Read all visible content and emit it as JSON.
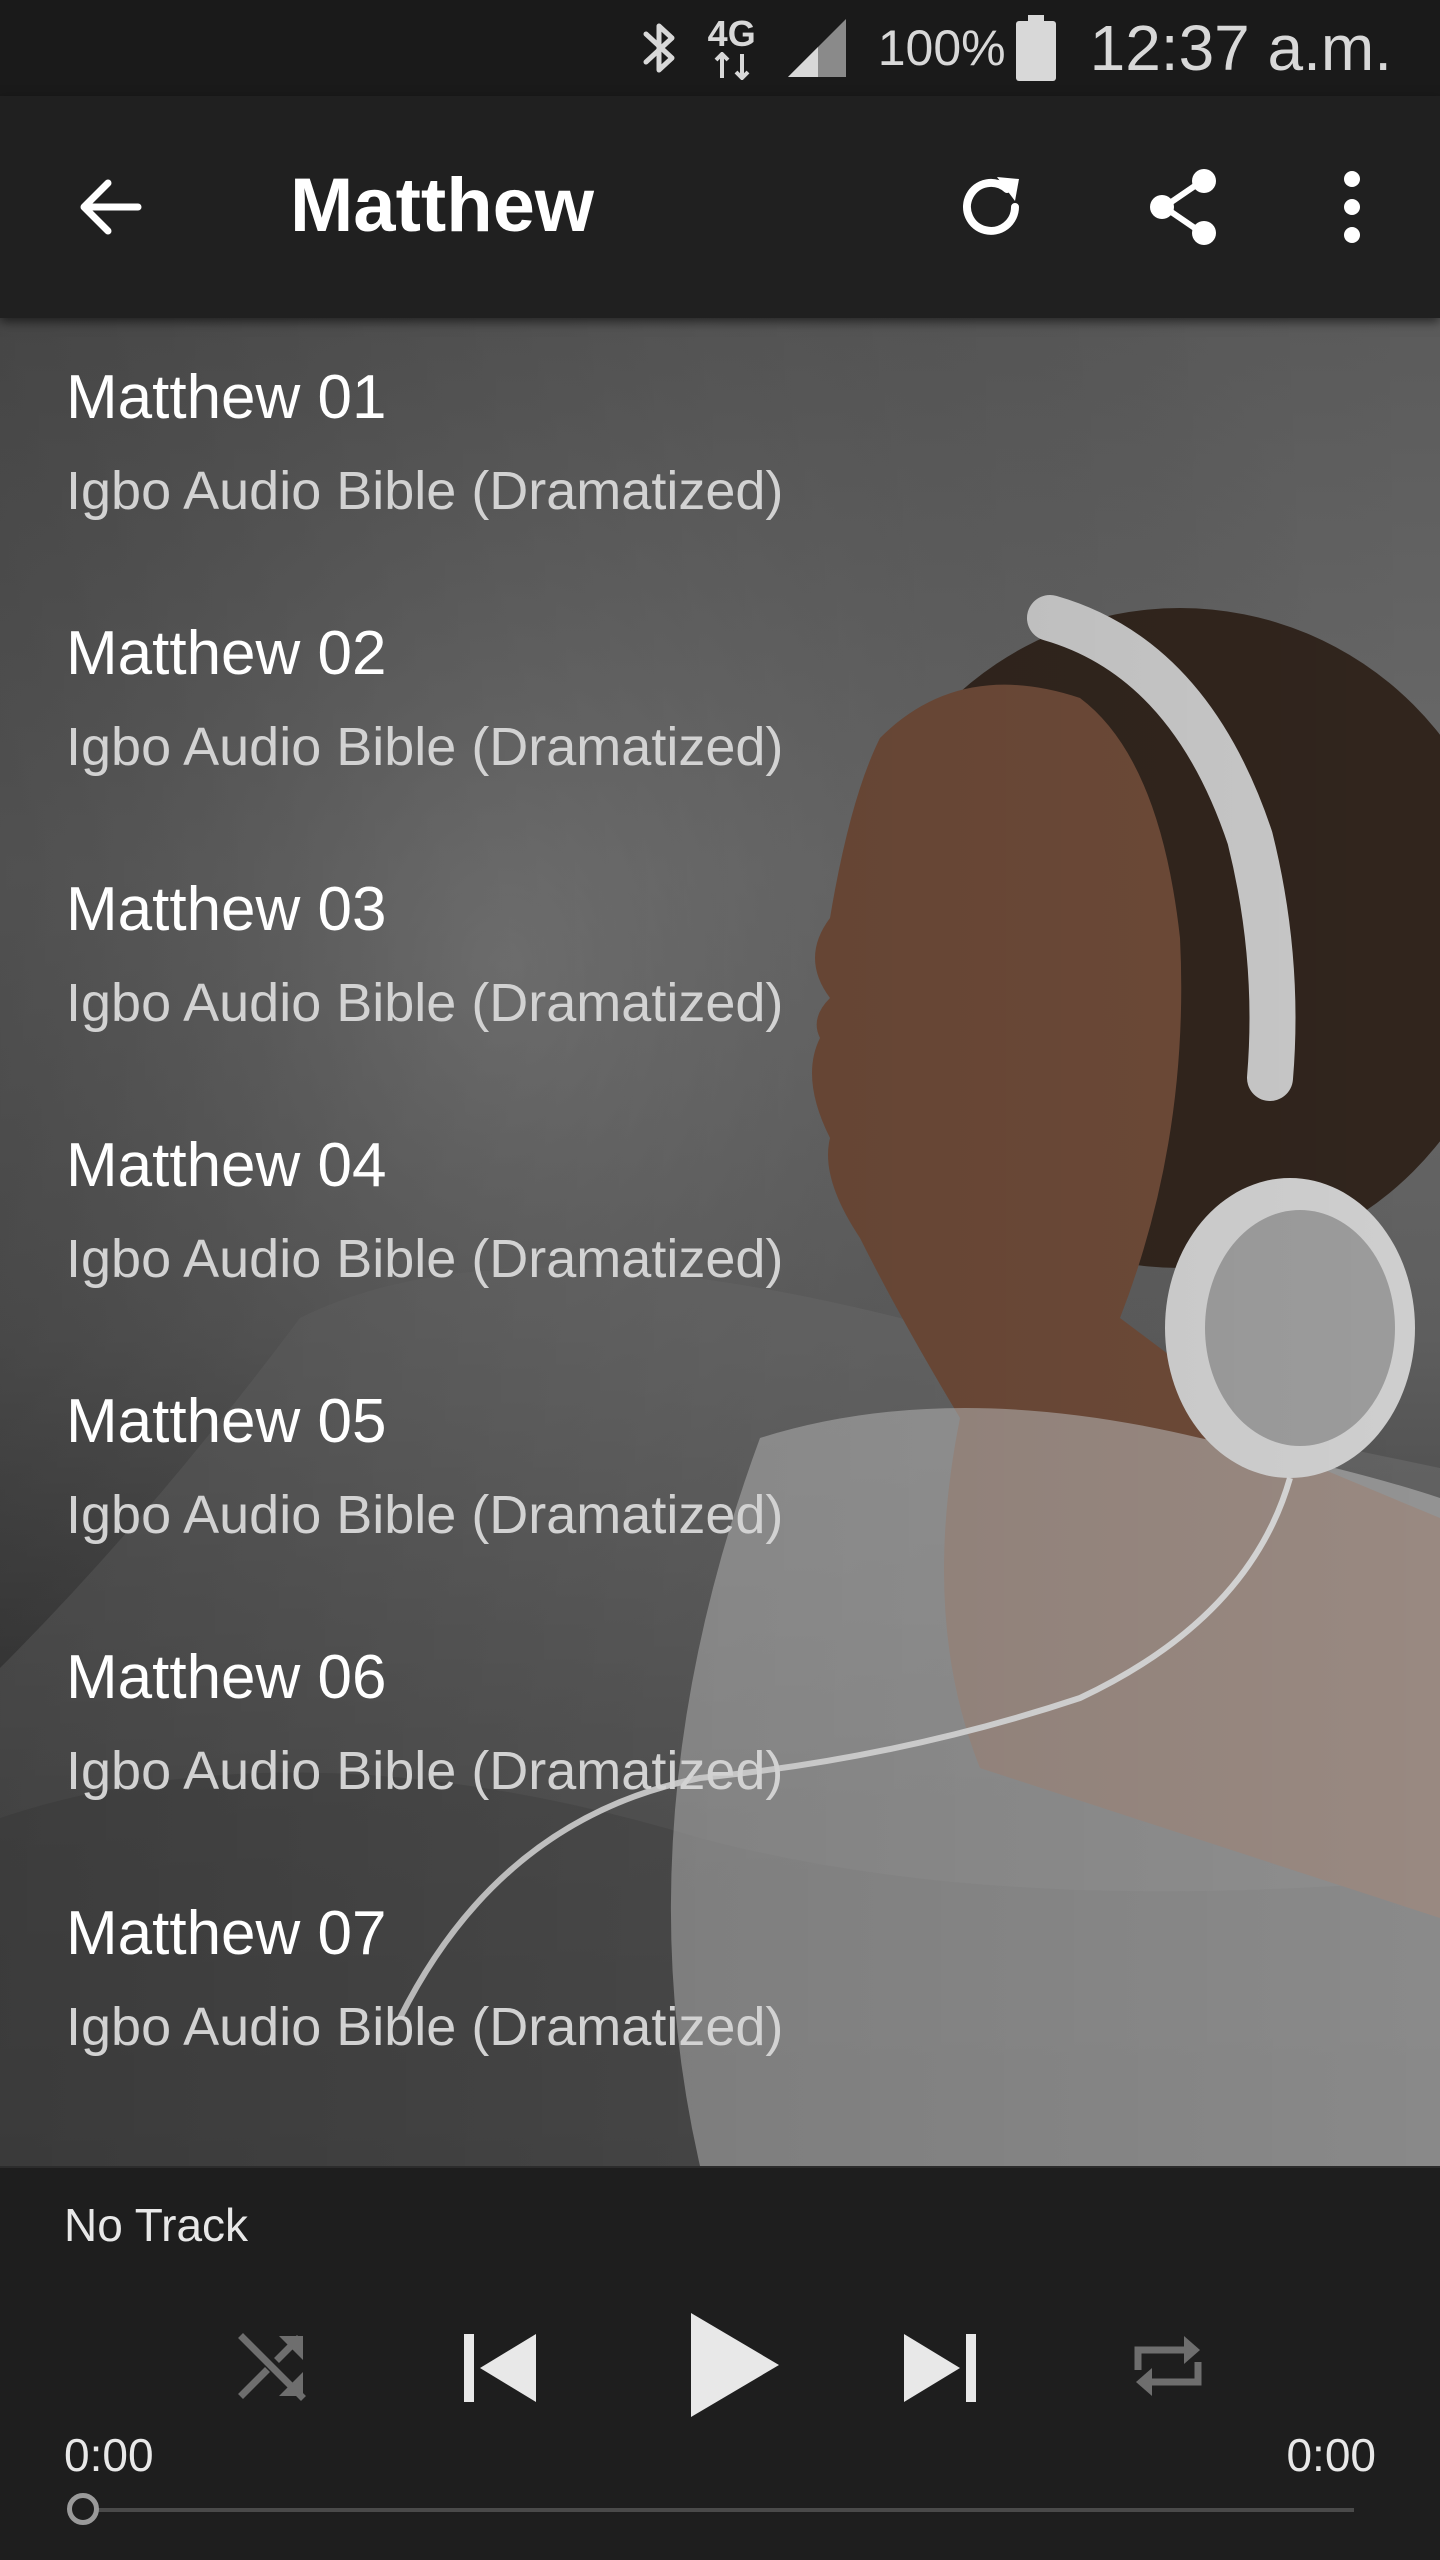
{
  "status_bar": {
    "network": "4G",
    "battery": "100%",
    "time": "12:37 a.m."
  },
  "app_bar": {
    "title": "Matthew",
    "icons": [
      "back-arrow-icon",
      "refresh-icon",
      "share-icon",
      "more-vert-icon"
    ]
  },
  "tracks": [
    {
      "title": "Matthew 01",
      "subtitle": "Igbo Audio Bible (Dramatized)"
    },
    {
      "title": "Matthew 02",
      "subtitle": "Igbo Audio Bible (Dramatized)"
    },
    {
      "title": "Matthew 03",
      "subtitle": "Igbo Audio Bible (Dramatized)"
    },
    {
      "title": "Matthew 04",
      "subtitle": "Igbo Audio Bible (Dramatized)"
    },
    {
      "title": "Matthew 05",
      "subtitle": "Igbo Audio Bible (Dramatized)"
    },
    {
      "title": "Matthew 06",
      "subtitle": "Igbo Audio Bible (Dramatized)"
    },
    {
      "title": "Matthew 07",
      "subtitle": "Igbo Audio Bible (Dramatized)"
    }
  ],
  "player": {
    "now_playing": "No Track",
    "elapsed": "0:00",
    "duration": "0:00",
    "progress": 0,
    "controls": [
      "shuffle-icon",
      "skip-previous-icon",
      "play-icon",
      "skip-next-icon",
      "repeat-icon"
    ]
  },
  "colors": {
    "app_bar": "#202020",
    "status_bar": "#1a1a1a",
    "player": "#1e1e1e",
    "text_primary": "#ffffff",
    "text_secondary": "#d2d2d2"
  }
}
